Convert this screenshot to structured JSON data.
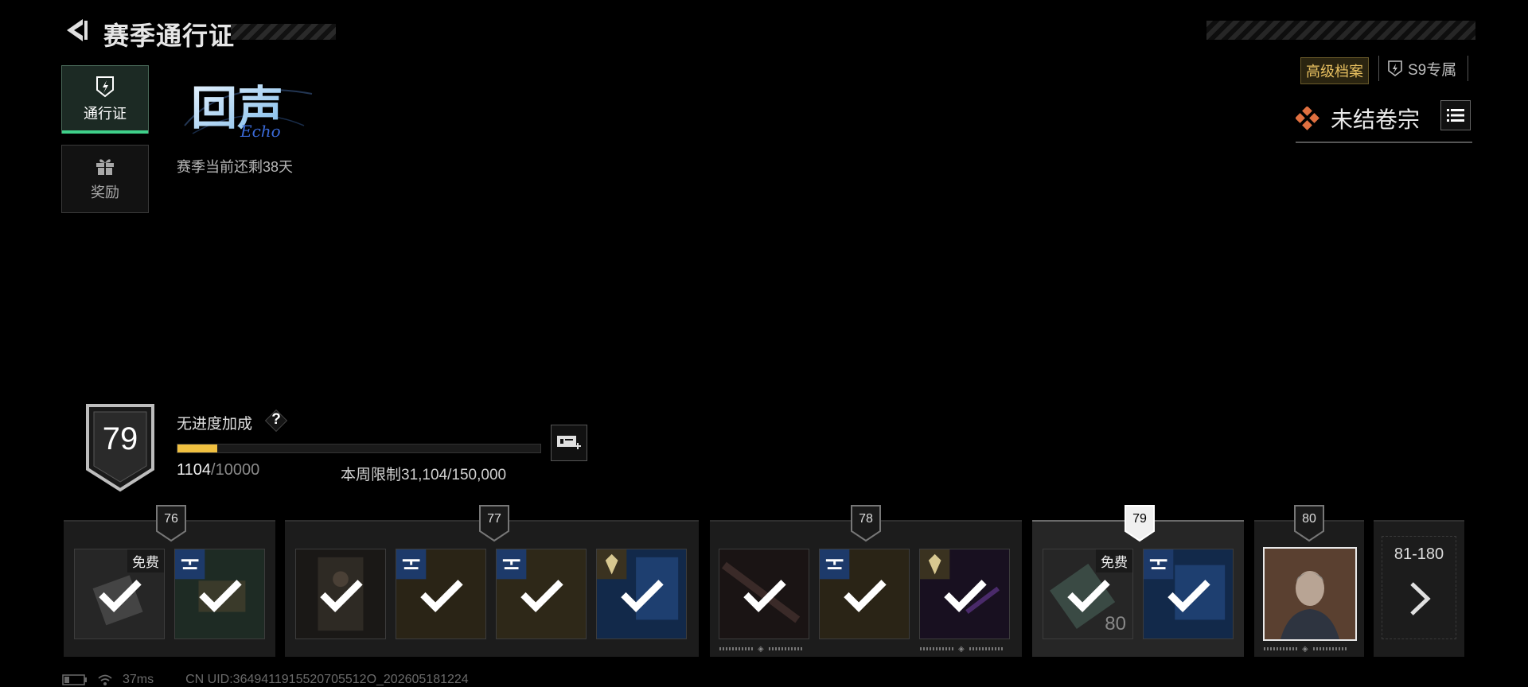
{
  "header": {
    "title": "赛季通行证"
  },
  "nav": {
    "tabs": [
      {
        "label": "通行证",
        "icon": "pass-shield-icon",
        "active": true
      },
      {
        "label": "奖励",
        "icon": "gift-icon",
        "active": false
      }
    ]
  },
  "season": {
    "logo_text": "回声",
    "logo_subtext": "Echo",
    "remaining": "赛季当前还剩38天"
  },
  "top_right": {
    "advanced_badge": "高级档案",
    "s9_badge": "S9专属",
    "dossier_label": "未结卷宗",
    "dossier_icon": "diamond-cluster-icon",
    "menu_icon": "list-icon"
  },
  "level": {
    "current": "79",
    "bonus_label": "无进度加成",
    "help": "?",
    "xp_current": "1104",
    "xp_max": "/10000",
    "xp_progress": 0.1104,
    "weekly_limit": "本周限制31,104/150,000",
    "boost_icon": "ticket-plus-icon"
  },
  "track": {
    "tiers": [
      {
        "level": "76",
        "current": false
      },
      {
        "level": "77",
        "current": false
      },
      {
        "level": "78",
        "current": false
      },
      {
        "level": "79",
        "current": true
      },
      {
        "level": "80",
        "current": false
      }
    ],
    "free_tag": "免费",
    "quantity_79": "80",
    "more_range": "81-180"
  },
  "status": {
    "ping": "37ms",
    "uid": "CN UID:3649411915520705512O_202605181224"
  },
  "colors": {
    "accent_green": "#3fd08a",
    "progress_yellow": "#f0c040",
    "gold_text": "#e8c060",
    "dossier_orange": "#e07040"
  }
}
